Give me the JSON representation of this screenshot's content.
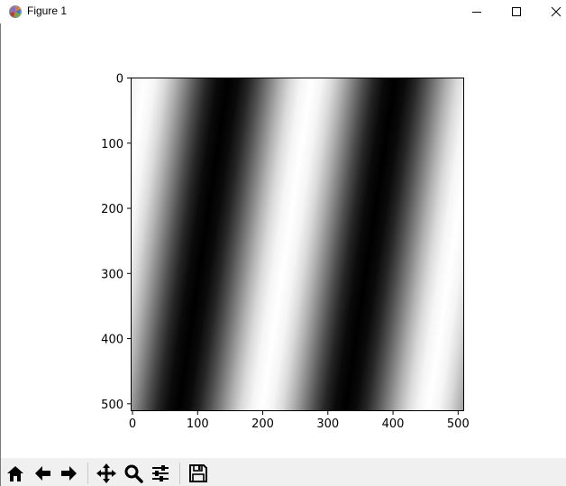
{
  "window": {
    "title": "Figure 1",
    "buttons": [
      "minimize",
      "maximize",
      "close"
    ]
  },
  "toolbar": {
    "buttons": [
      {
        "name": "home-icon",
        "label": "Home"
      },
      {
        "name": "back-icon",
        "label": "Back"
      },
      {
        "name": "forward-icon",
        "label": "Forward"
      },
      {
        "name": "pan-icon",
        "label": "Pan"
      },
      {
        "name": "zoom-icon",
        "label": "Zoom"
      },
      {
        "name": "subplots-icon",
        "label": "Configure subplots"
      },
      {
        "name": "save-icon",
        "label": "Save"
      }
    ]
  },
  "chart_data": {
    "type": "heatmap",
    "colormap": "gray",
    "image_size": [
      512,
      512
    ],
    "xlim": [
      0,
      512
    ],
    "ylim": [
      512,
      0
    ],
    "xticks": [
      0,
      100,
      200,
      300,
      400,
      500
    ],
    "yticks": [
      0,
      100,
      200,
      300,
      400,
      500
    ],
    "pattern": {
      "kind": "sinusoidal grating",
      "period_x": 256,
      "slant_dx_over_dy": -0.15,
      "white_crest_x_at_top": [
        22,
        278
      ],
      "black_trough_x_at_top": [
        150,
        406
      ]
    }
  }
}
